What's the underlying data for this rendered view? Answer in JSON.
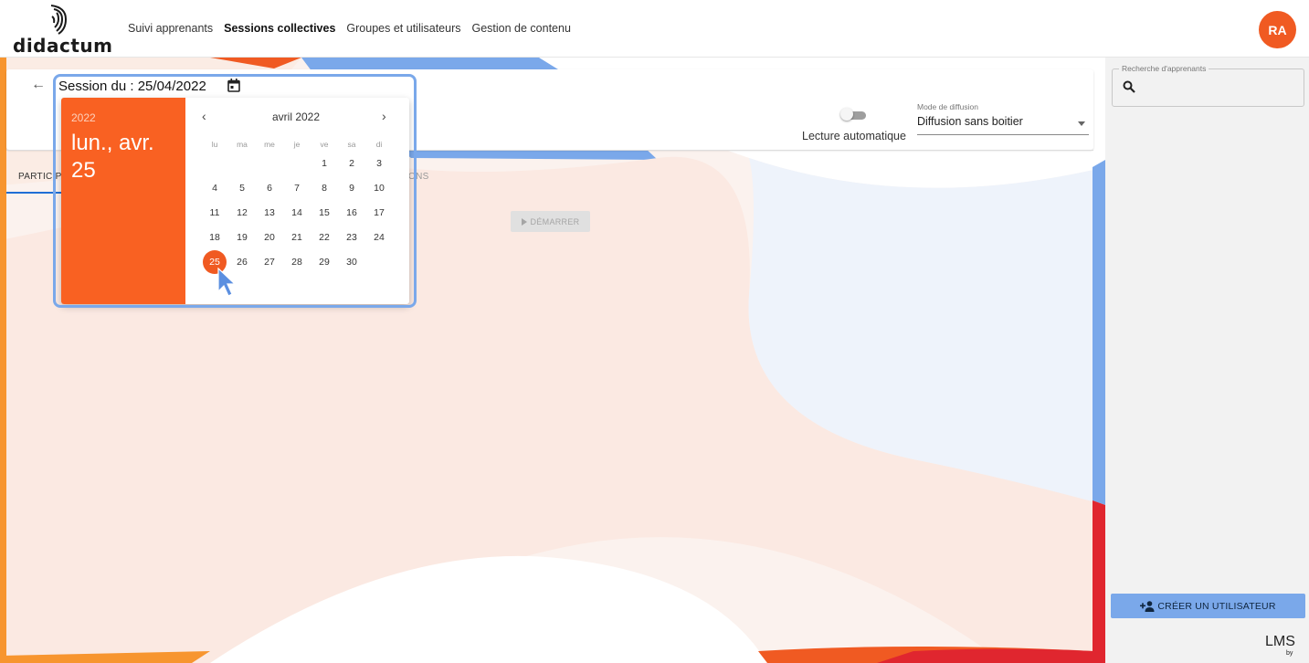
{
  "header": {
    "logo_text": "didactum",
    "nav": [
      "Suivi apprenants",
      "Sessions collectives",
      "Groupes et utilisateurs",
      "Gestion de contenu"
    ],
    "active_nav": "Sessions collectives",
    "avatar_initials": "RA",
    "accent_color": "#f05a22"
  },
  "session": {
    "title": "Session du : 25/04/2022",
    "autoplay_label": "Lecture automatique",
    "autoplay_on": false,
    "mode_label": "Mode de diffusion",
    "mode_value": "Diffusion sans boitier",
    "tab_participants": "PARTICIPANTS",
    "tab_other": "ONS",
    "start_button": "DÉMARRER"
  },
  "date_picker": {
    "year": "2022",
    "selected_date": "lun., avr. 25",
    "month_label": "avril 2022",
    "weekdays": [
      "lu",
      "ma",
      "me",
      "je",
      "ve",
      "sa",
      "di"
    ],
    "first_weekday_index": 4,
    "days_in_month": 30,
    "selected_day": 25,
    "selected_color": "#f96122"
  },
  "right_panel": {
    "search_label": "Recherche d'apprenants",
    "search_value": "",
    "create_user_button": "CRÉER UN UTILISATEUR",
    "brand_mark": "LMS",
    "brand_sub": "by"
  }
}
